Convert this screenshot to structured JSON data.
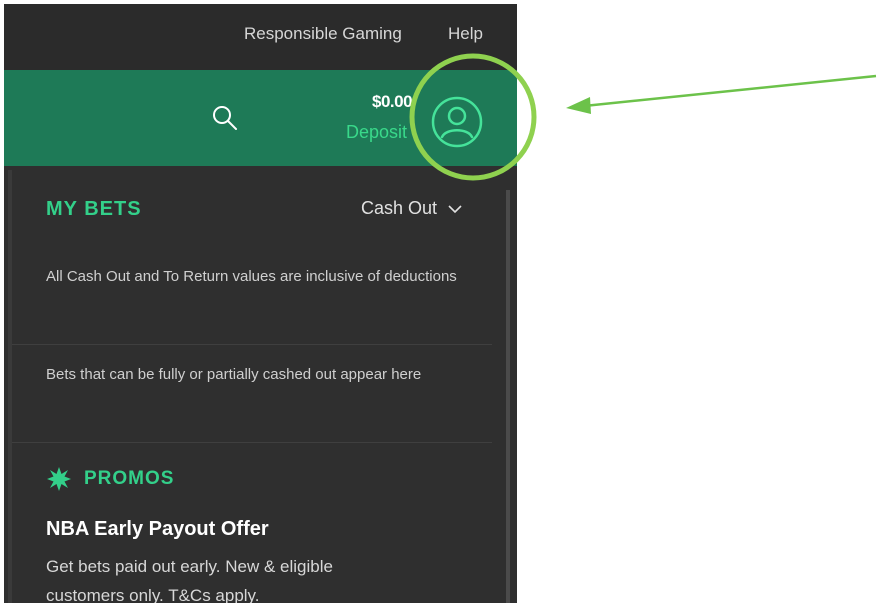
{
  "header": {
    "links": {
      "responsible_gaming": "Responsible Gaming",
      "help": "Help"
    }
  },
  "account_bar": {
    "balance": "$0.00",
    "deposit_label": "Deposit",
    "search_icon": "search-icon",
    "avatar_icon": "user-avatar-icon",
    "background_color": "#1e7a57",
    "accent_color": "#39d98a"
  },
  "my_bets": {
    "title": "MY BETS",
    "filter_label": "Cash Out",
    "notes": [
      "All Cash Out and To Return values are inclusive of deductions",
      "Bets that can be fully or partially cashed out appear here"
    ]
  },
  "promos": {
    "title": "PROMOS",
    "icon": "starburst-icon",
    "offer": {
      "title": "NBA Early Payout Offer",
      "description": "Get bets paid out early. New & eligible customers only. T&Cs apply."
    }
  },
  "annotation": {
    "highlight_color": "#8fd14f"
  }
}
